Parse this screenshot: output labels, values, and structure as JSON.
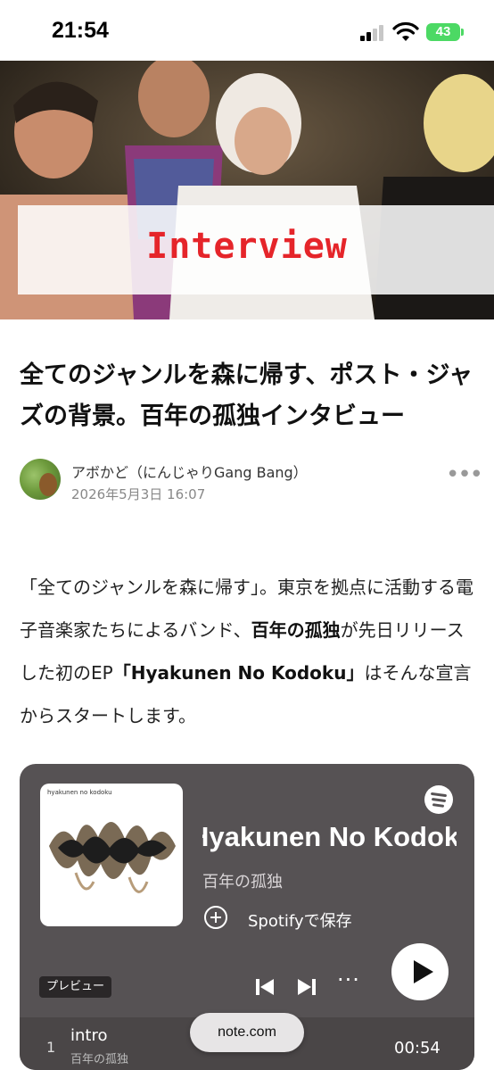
{
  "status_bar": {
    "time": "21:54",
    "battery": "43"
  },
  "hero": {
    "title": "Interview"
  },
  "article": {
    "title": "全てのジャンルを森に帰す、ポスト・ジャズの背景。百年の孤独インタビュー",
    "author": "アボかど（にんじゃりGang Bang）",
    "date": "2026年5月3日 16:07",
    "body": {
      "p1": "「全てのジャンルを森に帰す」。東京を拠点に活動する電子音楽家たちによるバンド、",
      "band": "百年の孤独",
      "p2": "が先日リリースした初のEP",
      "ep": "「Hyakunen No Kodoku」",
      "p3": "はそんな宣言からスタートします。"
    }
  },
  "embed": {
    "album_label": "hyakunen no kodoku",
    "album_title": "Hyakunen No Kodoku",
    "artist": "百年の孤独",
    "save_label": "Spotifyで保存",
    "preview_label": "プレビュー",
    "more": "···",
    "track": {
      "number": "1",
      "title": "intro",
      "subtitle": "百年の孤独",
      "duration": "00:54"
    }
  },
  "domain_pill": "note.com",
  "colors": {
    "accent_red": "#e5252a",
    "embed_bg": "#565254",
    "battery": "#4cd964"
  }
}
